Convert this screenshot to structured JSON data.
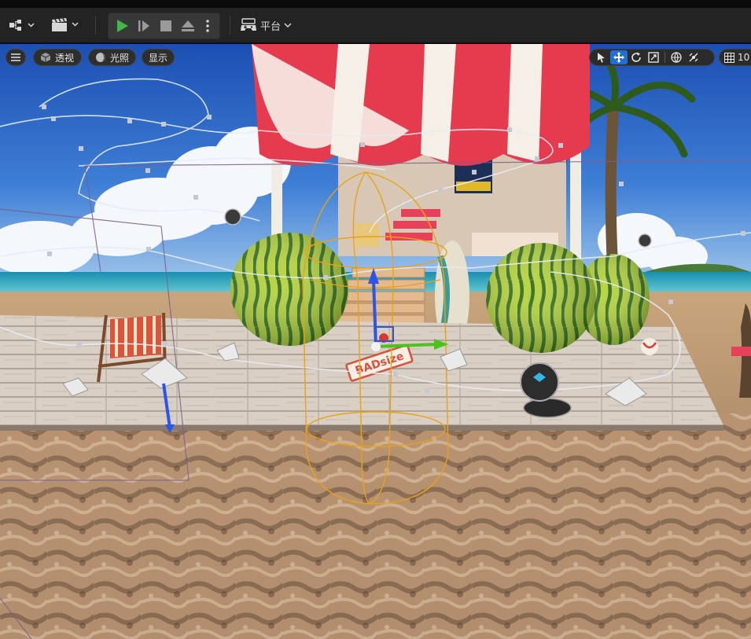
{
  "toolbar": {
    "mode_icon": "mode-select-icon",
    "cinematics_icon": "clapper-icon",
    "play_icon": "play-icon",
    "step_icon": "frame-step-icon",
    "stop_icon": "stop-icon",
    "eject_icon": "eject-icon",
    "more_icon": "more-vertical-icon",
    "platform_label": "平台",
    "platform_icon": "gamepad-icon"
  },
  "viewport": {
    "menu_icon": "hamburger-icon",
    "perspective_label": "透视",
    "lighting_label": "光照",
    "show_label": "显示",
    "right_tools": [
      "select-icon",
      "move-icon",
      "rotate-icon",
      "scale-icon",
      "world-icon",
      "surface-snap-icon",
      "grid-icon"
    ],
    "grid_value": "10",
    "scene_text": "BADsize"
  },
  "colors": {
    "play": "#3fb944",
    "active_tool": "#1f6fd4",
    "selection": "#e8a21a"
  }
}
